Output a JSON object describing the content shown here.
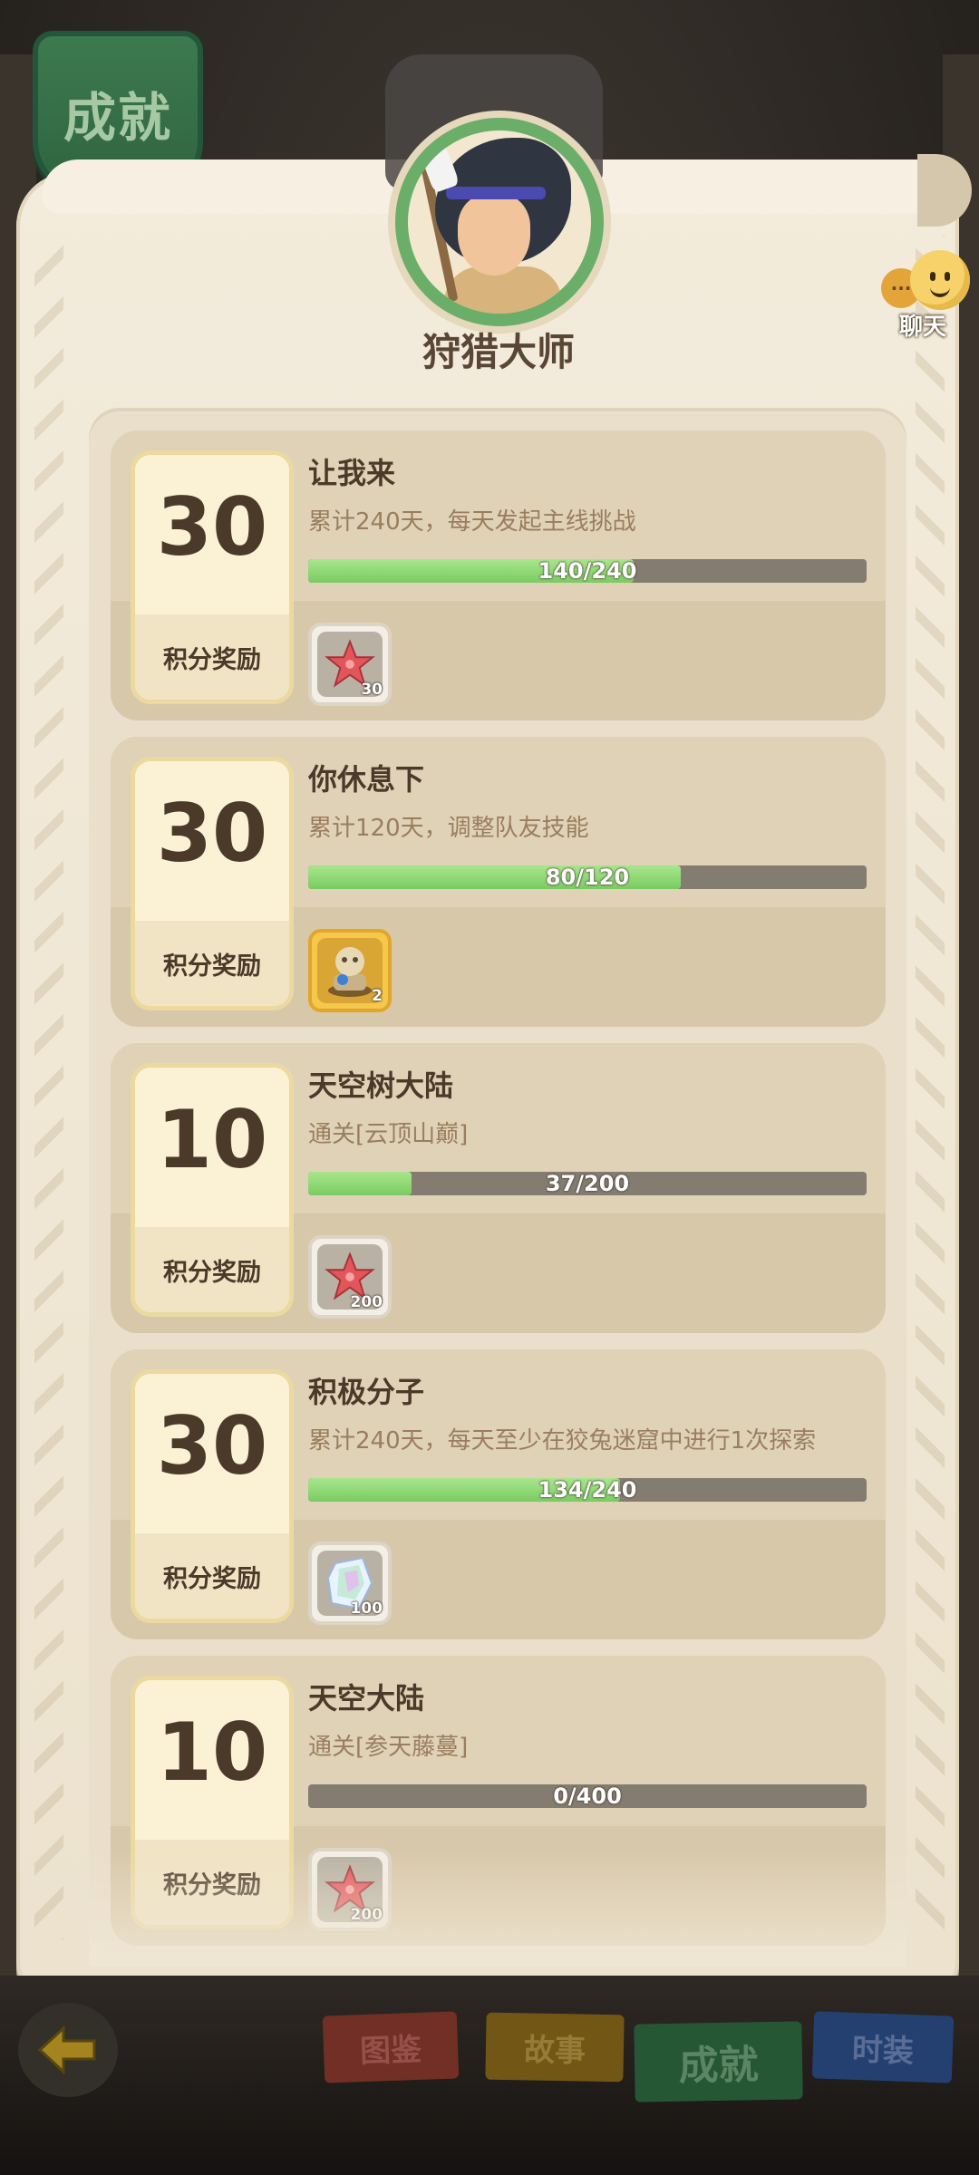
{
  "header": {
    "tab_label": "成就",
    "player_title": "狩猎大师"
  },
  "chat": {
    "label": "聊天",
    "back_bubble_text": "···"
  },
  "achievements": [
    {
      "points": "30",
      "points_label": "积分奖励",
      "title": "让我来",
      "description": "累计240天，每天发起主线挑战",
      "progress_text": "140/240",
      "progress": 0.583,
      "reward": {
        "icon": "red-starfish-icon",
        "count": "30",
        "frame": "silver"
      }
    },
    {
      "points": "30",
      "points_label": "积分奖励",
      "title": "你休息下",
      "description": "累计120天，调整队友技能",
      "progress_text": "80/120",
      "progress": 0.667,
      "reward": {
        "icon": "statue-icon",
        "count": "2",
        "frame": "gold"
      }
    },
    {
      "points": "10",
      "points_label": "积分奖励",
      "title": "天空树大陆",
      "description": "通关[云顶山巅]",
      "progress_text": "37/200",
      "progress": 0.185,
      "reward": {
        "icon": "red-starfish-icon",
        "count": "200",
        "frame": "silver"
      }
    },
    {
      "points": "30",
      "points_label": "积分奖励",
      "title": "积极分子",
      "description": "累计240天，每天至少在狡兔迷窟中进行1次探索",
      "progress_text": "134/240",
      "progress": 0.558,
      "reward": {
        "icon": "crystal-icon",
        "count": "100",
        "frame": "silver"
      }
    },
    {
      "points": "10",
      "points_label": "积分奖励",
      "title": "天空大陆",
      "description": "通关[参天藤蔓]",
      "progress_text": "0/400",
      "progress": 0,
      "reward": {
        "icon": "red-starfish-icon",
        "count": "200",
        "frame": "silver"
      }
    }
  ],
  "bottom_nav": {
    "tabs": [
      "图鉴",
      "故事",
      "成就",
      "时装"
    ],
    "active": "成就"
  },
  "colors": {
    "progress_fill": "#7acb62",
    "points_text": "#4b3a2a",
    "active_tab": "#2f6b40"
  }
}
